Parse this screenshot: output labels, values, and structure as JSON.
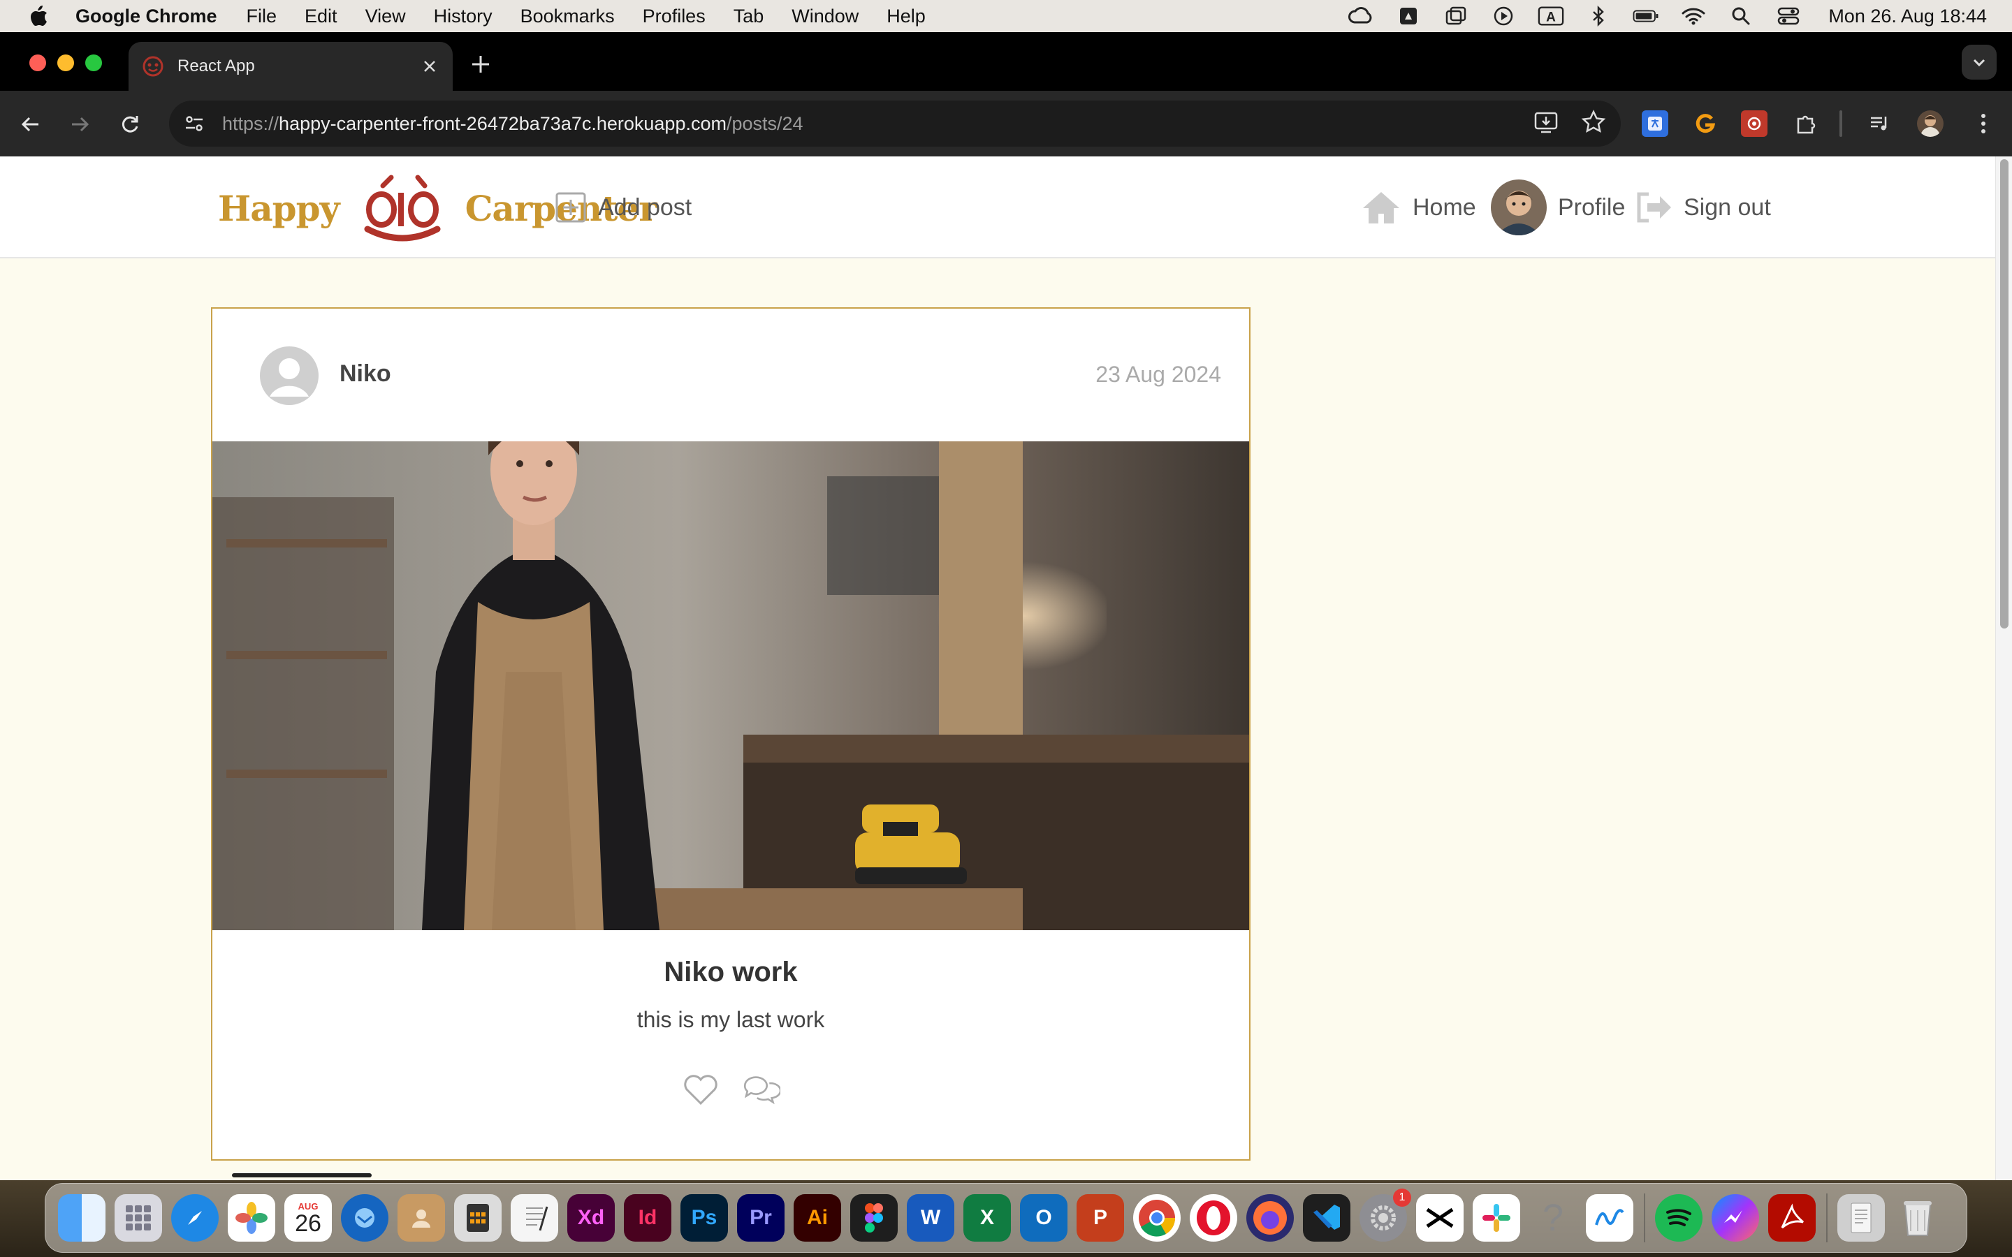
{
  "menubar": {
    "app_name": "Google Chrome",
    "items": [
      "File",
      "Edit",
      "View",
      "History",
      "Bookmarks",
      "Profiles",
      "Tab",
      "Window",
      "Help"
    ],
    "clock": "Mon 26. Aug  18:44",
    "input_indicator": "A"
  },
  "browser": {
    "tab_title": "React App",
    "url_scheme": "https://",
    "url_host": "happy-carpenter-front-26472ba73a7c.herokuapp.com",
    "url_path": "/posts/24"
  },
  "site": {
    "logo_left": "Happy",
    "logo_right": "Carpenter",
    "add_post_label": "Add post",
    "home_label": "Home",
    "profile_label": "Profile",
    "sign_out_label": "Sign out"
  },
  "post": {
    "owner": "Niko",
    "date": "23 Aug 2024",
    "title": "Niko work",
    "content": "this is my last work"
  },
  "dock": {
    "calendar_month": "AUG",
    "calendar_day": "26",
    "settings_badge": "1",
    "labels": {
      "xd": "Xd",
      "id": "Id",
      "ps": "Ps",
      "pr": "Pr",
      "ai": "Ai",
      "word": "W",
      "excel": "X",
      "outlook": "O",
      "powerpoint": "P",
      "help": "?"
    }
  },
  "colors": {
    "logo_gold": "#c9962f",
    "logo_red": "#b0332a",
    "page_bg": "#fdfbee",
    "card_border": "#c9a24a"
  }
}
